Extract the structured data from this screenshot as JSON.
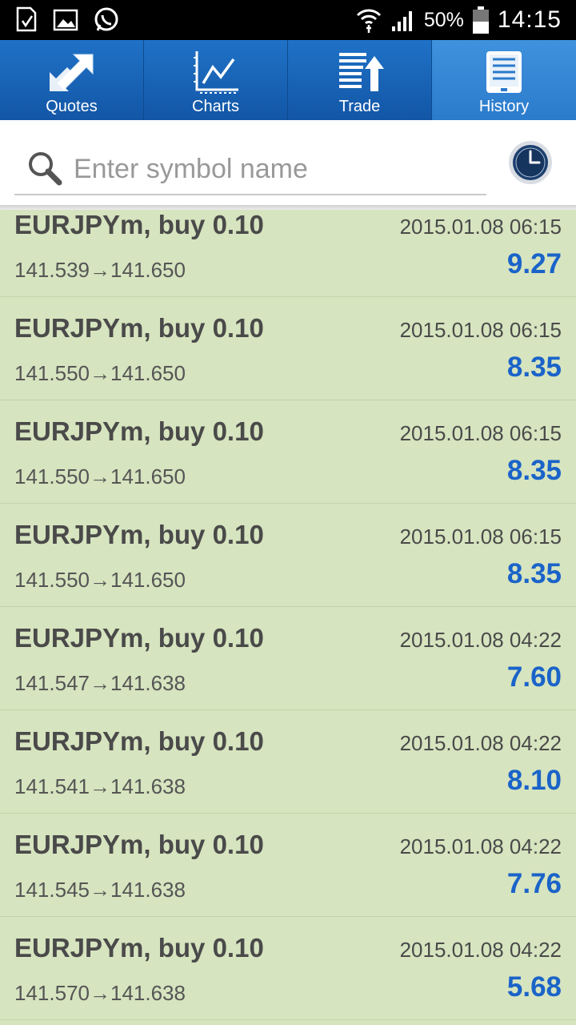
{
  "status_bar": {
    "battery": "50%",
    "time": "14:15"
  },
  "tabs": [
    {
      "label": "Quotes",
      "icon": "quotes-arrows-icon"
    },
    {
      "label": "Charts",
      "icon": "chart-line-icon"
    },
    {
      "label": "Trade",
      "icon": "trade-list-icon"
    },
    {
      "label": "History",
      "icon": "history-book-icon",
      "active": true
    }
  ],
  "search": {
    "placeholder": "Enter symbol name"
  },
  "history": [
    {
      "symbol": "EURJPYm, buy 0.10",
      "date": "2015.01.08 06:15",
      "prices": "141.539→141.650",
      "profit": "9.27"
    },
    {
      "symbol": "EURJPYm, buy 0.10",
      "date": "2015.01.08 06:15",
      "prices": "141.550→141.650",
      "profit": "8.35"
    },
    {
      "symbol": "EURJPYm, buy 0.10",
      "date": "2015.01.08 06:15",
      "prices": "141.550→141.650",
      "profit": "8.35"
    },
    {
      "symbol": "EURJPYm, buy 0.10",
      "date": "2015.01.08 06:15",
      "prices": "141.550→141.650",
      "profit": "8.35"
    },
    {
      "symbol": "EURJPYm, buy 0.10",
      "date": "2015.01.08 04:22",
      "prices": "141.547→141.638",
      "profit": "7.60"
    },
    {
      "symbol": "EURJPYm, buy 0.10",
      "date": "2015.01.08 04:22",
      "prices": "141.541→141.638",
      "profit": "8.10"
    },
    {
      "symbol": "EURJPYm, buy 0.10",
      "date": "2015.01.08 04:22",
      "prices": "141.545→141.638",
      "profit": "7.76"
    },
    {
      "symbol": "EURJPYm, buy 0.10",
      "date": "2015.01.08 04:22",
      "prices": "141.570→141.638",
      "profit": "5.68"
    }
  ],
  "colors": {
    "tab_bar": "#1356a6",
    "tab_active": "#2a7acb",
    "list_bg": "#d6e4bf",
    "profit": "#1a63c9"
  }
}
